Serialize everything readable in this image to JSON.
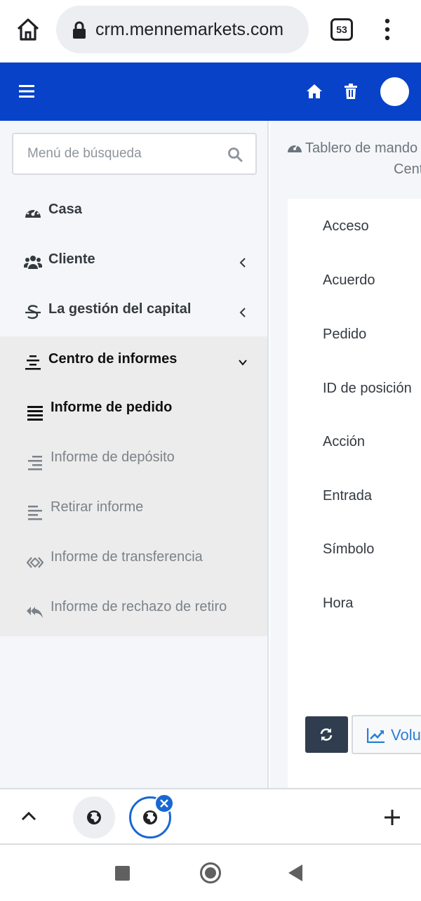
{
  "browser": {
    "url": "crm.mennemarkets.com",
    "tab_count": "53"
  },
  "search": {
    "placeholder": "Menú de búsqueda"
  },
  "sidebar": {
    "items": [
      {
        "label": "Casa",
        "icon": "dashboard-gauge-icon"
      },
      {
        "label": "Cliente",
        "icon": "users-icon"
      },
      {
        "label": "La gestión del capital",
        "icon": "strikethrough-s-icon"
      },
      {
        "label": "Centro de informes",
        "icon": "align-center-icon"
      }
    ],
    "subitems": [
      {
        "label": "Informe de pedido",
        "icon": "list-bars-icon"
      },
      {
        "label": "Informe de depósito",
        "icon": "align-right-icon"
      },
      {
        "label": "Retirar informe",
        "icon": "align-left-icon"
      },
      {
        "label": "Informe de transferencia",
        "icon": "transfer-icon"
      },
      {
        "label": "Informe de rechazo de retiro",
        "icon": "reply-all-icon"
      }
    ]
  },
  "main": {
    "breadcrumb": "Tablero de mando",
    "breadcrumb_sub": "Centro de informes",
    "fields": [
      "Acceso",
      "Acuerdo",
      "Pedido",
      "ID de posición",
      "Acción",
      "Entrada",
      "Símbolo",
      "Hora"
    ],
    "volume_label": "Volumen"
  },
  "colors": {
    "header": "#0742c9",
    "sidebar": "#f4f6f9",
    "refresh_button": "#2f3d4e",
    "link": "#2b7fd6"
  }
}
